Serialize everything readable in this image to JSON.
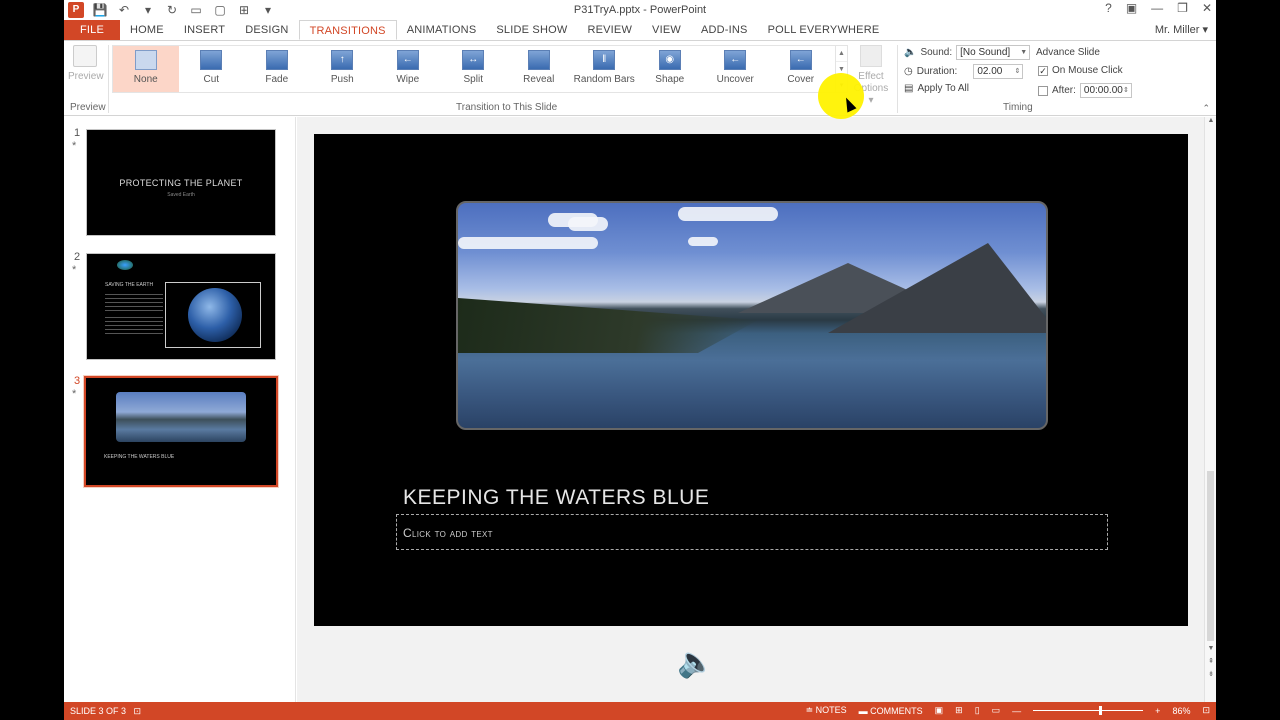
{
  "app": {
    "title": "P31TryA.pptx - PowerPoint",
    "user": "Mr. Miller",
    "window_controls": [
      "?",
      "▣",
      "—",
      "❐",
      "✕"
    ]
  },
  "qat": [
    "P",
    "💾",
    "↶",
    "▾",
    "↻",
    "▭",
    "▢",
    "⊞",
    "▾"
  ],
  "tabs": [
    "FILE",
    "HOME",
    "INSERT",
    "DESIGN",
    "TRANSITIONS",
    "ANIMATIONS",
    "SLIDE SHOW",
    "REVIEW",
    "VIEW",
    "ADD-INS",
    "POLL EVERYWHERE"
  ],
  "active_tab": "TRANSITIONS",
  "ribbon": {
    "preview_label": "Preview",
    "preview_group": "Preview",
    "transitions": [
      {
        "label": "None",
        "glyph": "",
        "selected": true
      },
      {
        "label": "Cut",
        "glyph": "",
        "selected": false
      },
      {
        "label": "Fade",
        "glyph": "",
        "selected": false
      },
      {
        "label": "Push",
        "glyph": "↑",
        "selected": false
      },
      {
        "label": "Wipe",
        "glyph": "←",
        "selected": false
      },
      {
        "label": "Split",
        "glyph": "↔",
        "selected": false
      },
      {
        "label": "Reveal",
        "glyph": "",
        "selected": false
      },
      {
        "label": "Random Bars",
        "glyph": "‖",
        "selected": false
      },
      {
        "label": "Shape",
        "glyph": "◉",
        "selected": false
      },
      {
        "label": "Uncover",
        "glyph": "←",
        "selected": false
      },
      {
        "label": "Cover",
        "glyph": "←",
        "selected": false
      }
    ],
    "transition_group": "Transition to This Slide",
    "effect_options_line1": "Effect",
    "effect_options_line2": "Options",
    "sound_label": "Sound:",
    "sound_value": "[No Sound]",
    "duration_label": "Duration:",
    "duration_value": "02.00",
    "apply_all": "Apply To All",
    "advance_label": "Advance Slide",
    "on_mouse_click": "On Mouse Click",
    "after_label": "After:",
    "after_value": "00:00.00",
    "timing_group": "Timing"
  },
  "slides": [
    {
      "num": "1",
      "star": "*",
      "title": "PROTECTING THE PLANET",
      "subtitle": "Saved Earth"
    },
    {
      "num": "2",
      "star": "*",
      "title": "SAVING THE EARTH"
    },
    {
      "num": "3",
      "star": "*",
      "title": "KEEPING THE WATERS BLUE"
    }
  ],
  "current_slide": {
    "title": "KEEPING THE WATERS BLUE",
    "subtitle_placeholder": "Click to add text"
  },
  "status": {
    "slide_info": "SLIDE 3 OF 3",
    "notes": "NOTES",
    "comments": "COMMENTS",
    "zoom": "86%"
  },
  "colors": {
    "accent": "#d24726",
    "selected_transition": "#fcd6c8",
    "cursor_highlight": "#fff200"
  }
}
